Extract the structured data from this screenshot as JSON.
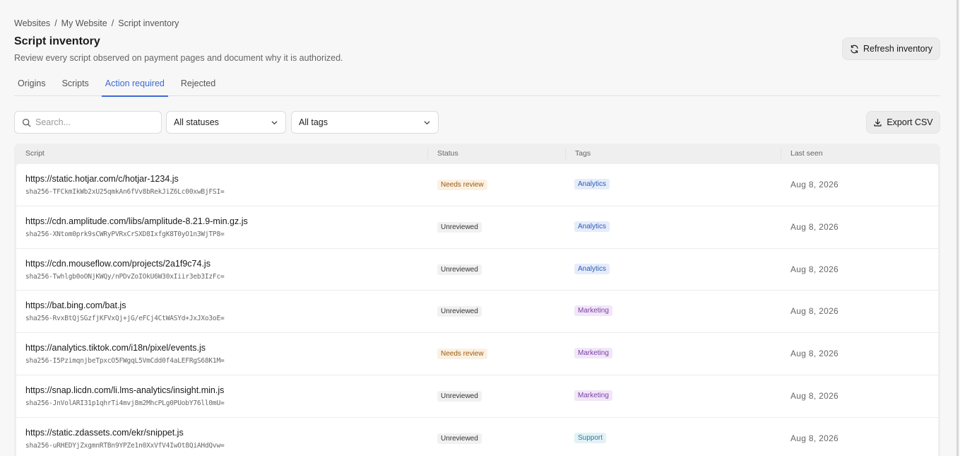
{
  "breadcrumb": [
    "Websites",
    "My Website",
    "Script inventory"
  ],
  "header": {
    "title": "Script inventory",
    "subtitle": "Review every script observed on payment pages and document why it is authorized.",
    "refresh_label": "Refresh inventory"
  },
  "tabs": [
    {
      "label": "Origins"
    },
    {
      "label": "Scripts"
    },
    {
      "label": "Action required",
      "active": true
    },
    {
      "label": "Rejected"
    }
  ],
  "filters": {
    "search_placeholder": "Search...",
    "status_value": "All statuses",
    "tags_value": "All tags",
    "export_label": "Export CSV"
  },
  "table": {
    "columns": [
      "Script",
      "Status",
      "Tags",
      "Last seen"
    ],
    "rows": [
      {
        "url": "https://static.hotjar.com/c/hotjar-1234.js",
        "hash": "sha256-TFCkmIkWb2xU25qmkAn6fVv8bRekJiZ6Lc00xwBjFSI=",
        "status": "Needs review",
        "status_kind": "review",
        "tag": "Analytics",
        "tag_kind": "analytics",
        "last_seen": "Aug 8, 2026"
      },
      {
        "url": "https://cdn.amplitude.com/libs/amplitude-8.21.9-min.gz.js",
        "hash": "sha256-XNtom0prk9sCWRyPVRxCrSXD8IxfgK8T0yO1n3WjTP8=",
        "status": "Unreviewed",
        "status_kind": "unreviewed",
        "tag": "Analytics",
        "tag_kind": "analytics",
        "last_seen": "Aug 8, 2026"
      },
      {
        "url": "https://cdn.mouseflow.com/projects/2a1f9c74.js",
        "hash": "sha256-Twhlgb0oONjKWQy/nPDvZoIOkU6W30xIiir3eb3IzFc=",
        "status": "Unreviewed",
        "status_kind": "unreviewed",
        "tag": "Analytics",
        "tag_kind": "analytics",
        "last_seen": "Aug 8, 2026"
      },
      {
        "url": "https://bat.bing.com/bat.js",
        "hash": "sha256-RvxBtQjSGzfjKFVxQj+jG/eFCj4CtWASYd+JxJXo3oE=",
        "status": "Unreviewed",
        "status_kind": "unreviewed",
        "tag": "Marketing",
        "tag_kind": "marketing",
        "last_seen": "Aug 8, 2026"
      },
      {
        "url": "https://analytics.tiktok.com/i18n/pixel/events.js",
        "hash": "sha256-I5PzimqnjbeTpxcO5FWgqL5VmCdd0f4aLEFRgS68K1M=",
        "status": "Needs review",
        "status_kind": "review",
        "tag": "Marketing",
        "tag_kind": "marketing",
        "last_seen": "Aug 8, 2026"
      },
      {
        "url": "https://snap.licdn.com/li.lms-analytics/insight.min.js",
        "hash": "sha256-JnVolARI31p1qhrTi4mvj8m2MhcPLg0PUobY76ll0mU=",
        "status": "Unreviewed",
        "status_kind": "unreviewed",
        "tag": "Marketing",
        "tag_kind": "marketing",
        "last_seen": "Aug 8, 2026"
      },
      {
        "url": "https://static.zdassets.com/ekr/snippet.js",
        "hash": "sha256-uRHEDYjZxgmnRTBn9YPZe1n0XxVfV4IwOt8QiAHdQvw=",
        "status": "Unreviewed",
        "status_kind": "unreviewed",
        "tag": "Support",
        "tag_kind": "support",
        "last_seen": "Aug 8, 2026"
      }
    ]
  },
  "colors": {
    "accent": "#3b6bd6",
    "background": "#f7f7f7"
  }
}
